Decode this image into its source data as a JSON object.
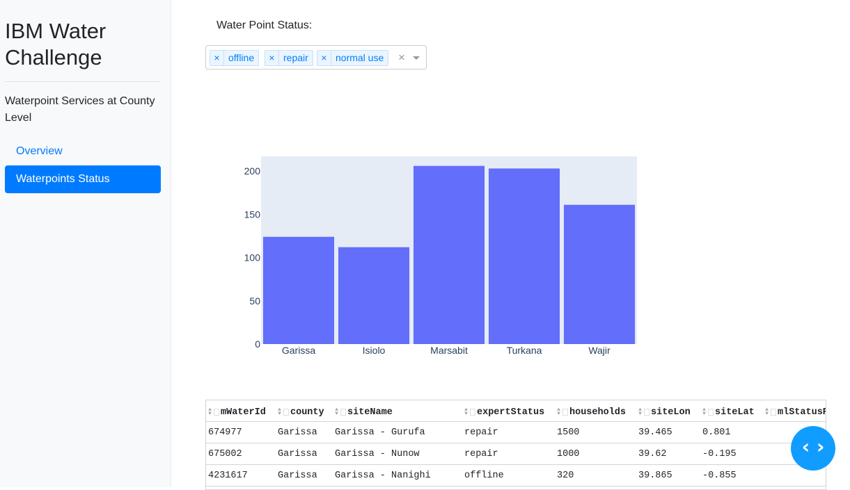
{
  "sidebar": {
    "title_line1": "IBM Water",
    "title_line2": "Challenge",
    "lead": "Waterpoint Services at County Level",
    "nav": [
      {
        "label": "Overview",
        "active": false
      },
      {
        "label": "Waterpoints Status",
        "active": true
      }
    ]
  },
  "filter": {
    "label": "Water Point Status:",
    "tags": [
      "offline",
      "repair",
      "normal use"
    ],
    "remove_glyph": "×",
    "clear_glyph": "×"
  },
  "colors": {
    "accent": "#007bff",
    "bar": "#636efa",
    "plot_bg": "#e5ecf6",
    "fab": "#119dff"
  },
  "chart_data": {
    "type": "bar",
    "categories": [
      "Garissa",
      "Isiolo",
      "Marsabit",
      "Turkana",
      "Wajir"
    ],
    "values": [
      124,
      112,
      206,
      203,
      161
    ],
    "yticks": [
      0,
      50,
      100,
      150,
      200
    ],
    "ylim": [
      0,
      217
    ],
    "grid": false
  },
  "table": {
    "columns": [
      "mWaterId",
      "county",
      "siteName",
      "expertStatus",
      "households",
      "siteLon",
      "siteLat",
      "mlStatusPr"
    ],
    "rows": [
      [
        "674977",
        "Garissa",
        "Garissa - Gurufa",
        "repair",
        "1500",
        "39.465",
        "0.801",
        ""
      ],
      [
        "675002",
        "Garissa",
        "Garissa - Nunow",
        "repair",
        "1000",
        "39.62",
        "-0.195",
        ""
      ],
      [
        "4231617",
        "Garissa",
        "Garissa - Nanighi",
        "offline",
        "320",
        "39.865",
        "-0.855",
        ""
      ]
    ]
  },
  "fab": {
    "icon": "code-icon",
    "glyph": "‹ ›"
  }
}
